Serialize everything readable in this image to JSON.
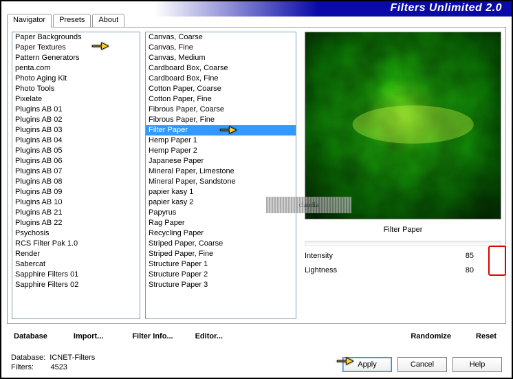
{
  "title": "Filters Unlimited 2.0",
  "tabs": [
    {
      "label": "Navigator"
    },
    {
      "label": "Presets"
    },
    {
      "label": "About"
    }
  ],
  "activeTab": 0,
  "leftList": [
    "Paper Backgrounds",
    "Paper Textures",
    "Pattern Generators",
    "penta.com",
    "Photo Aging Kit",
    "Photo Tools",
    "Pixelate",
    "Plugins AB 01",
    "Plugins AB 02",
    "Plugins AB 03",
    "Plugins AB 04",
    "Plugins AB 05",
    "Plugins AB 06",
    "Plugins AB 07",
    "Plugins AB 08",
    "Plugins AB 09",
    "Plugins AB 10",
    "Plugins AB 21",
    "Plugins AB 22",
    "Psychosis",
    "RCS Filter Pak 1.0",
    "Render",
    "Sabercat",
    "Sapphire Filters 01",
    "Sapphire Filters 02"
  ],
  "leftPointedIndex": 1,
  "rightList": [
    "Canvas, Coarse",
    "Canvas, Fine",
    "Canvas, Medium",
    "Cardboard Box, Coarse",
    "Cardboard Box, Fine",
    "Cotton Paper, Coarse",
    "Cotton Paper, Fine",
    "Fibrous Paper, Coarse",
    "Fibrous Paper, Fine",
    "Filter Paper",
    "Hemp Paper 1",
    "Hemp Paper 2",
    "Japanese Paper",
    "Mineral Paper, Limestone",
    "Mineral Paper, Sandstone",
    "papier kasy 1",
    "papier kasy 2",
    "Papyrus",
    "Rag Paper",
    "Recycling Paper",
    "Striped Paper, Coarse",
    "Striped Paper, Fine",
    "Structure Paper 1",
    "Structure Paper 2",
    "Structure Paper 3"
  ],
  "rightSelectedIndex": 9,
  "previewLabel": "Filter Paper",
  "sliders": [
    {
      "label": "Intensity",
      "value": "85"
    },
    {
      "label": "Lightness",
      "value": "80"
    }
  ],
  "footerButtons": {
    "database": "Database",
    "import": "Import...",
    "filterInfo": "Filter Info...",
    "editor": "Editor...",
    "randomize": "Randomize",
    "reset": "Reset"
  },
  "actionButtons": {
    "apply": "Apply",
    "cancel": "Cancel",
    "help": "Help"
  },
  "status": {
    "dbLabel": "Database:",
    "dbValue": "ICNET-Filters",
    "filtersLabel": "Filters:",
    "filtersValue": "4523"
  },
  "watermark": "claudia"
}
